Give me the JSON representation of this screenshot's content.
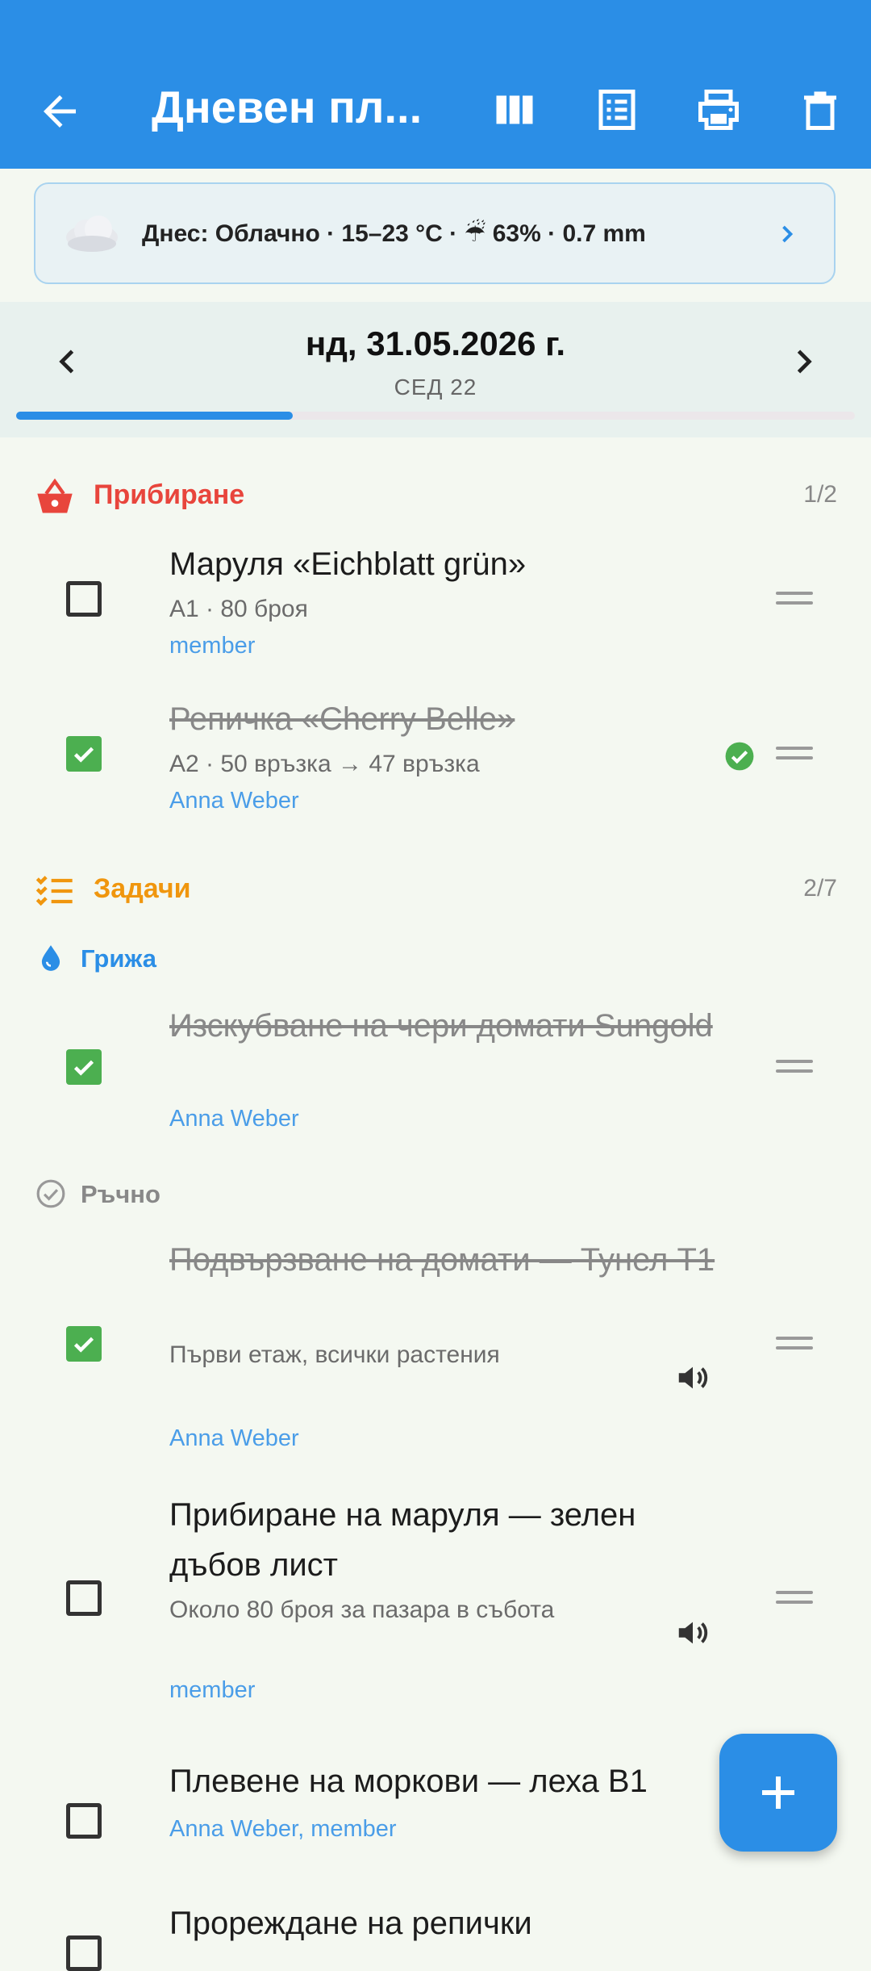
{
  "appbar": {
    "title": "Дневен пл...",
    "accent": "#2b8ee6",
    "icons": [
      "back-arrow-icon",
      "columns-icon",
      "list-view-icon",
      "print-icon",
      "delete-icon"
    ]
  },
  "weather": {
    "icon": "cloud-icon",
    "text": "Днес: Облачно · 15–23 °C · ☔ 63% · 0.7 mm"
  },
  "date_nav": {
    "date": "нд, 31.05.2026 г.",
    "week": "СЕД 22",
    "progress": 0.33
  },
  "harvest": {
    "title": "Прибиране",
    "count": "1/2",
    "color": "#e8453c",
    "items": [
      {
        "name": "Маруля «Eichblatt grün»",
        "meta": "A1 · 80 броя",
        "person": "member",
        "done": false
      },
      {
        "name": "Репичка «Cherry Belle»",
        "meta": "A2 · 50 връзка → 47 връзка",
        "person": "Anna Weber",
        "done": true
      }
    ]
  },
  "tasks": {
    "title": "Задачи",
    "count": "2/7",
    "color": "#f0960e",
    "care": {
      "title": "Грижа",
      "items": [
        {
          "name": "Изскубване на чери домати Sungold",
          "person": "Anna Weber",
          "done": true
        }
      ]
    },
    "manual": {
      "title": "Ръчно",
      "items": [
        {
          "name": "Подвързване на домати — Тунел T1",
          "meta": "Първи етаж, всички растения",
          "person": "Anna Weber",
          "done": true
        },
        {
          "name": "Прибиране на маруля — зелен дъбов лист",
          "meta": "Около 80 броя за пазара в събота",
          "person": "member",
          "done": false
        },
        {
          "name": "Плевене на моркови — леха B1",
          "person": "Anna Weber, member",
          "done": false
        },
        {
          "name": "Прореждане на репички",
          "done": false
        }
      ]
    }
  },
  "fab": {
    "icon": "plus-icon"
  }
}
